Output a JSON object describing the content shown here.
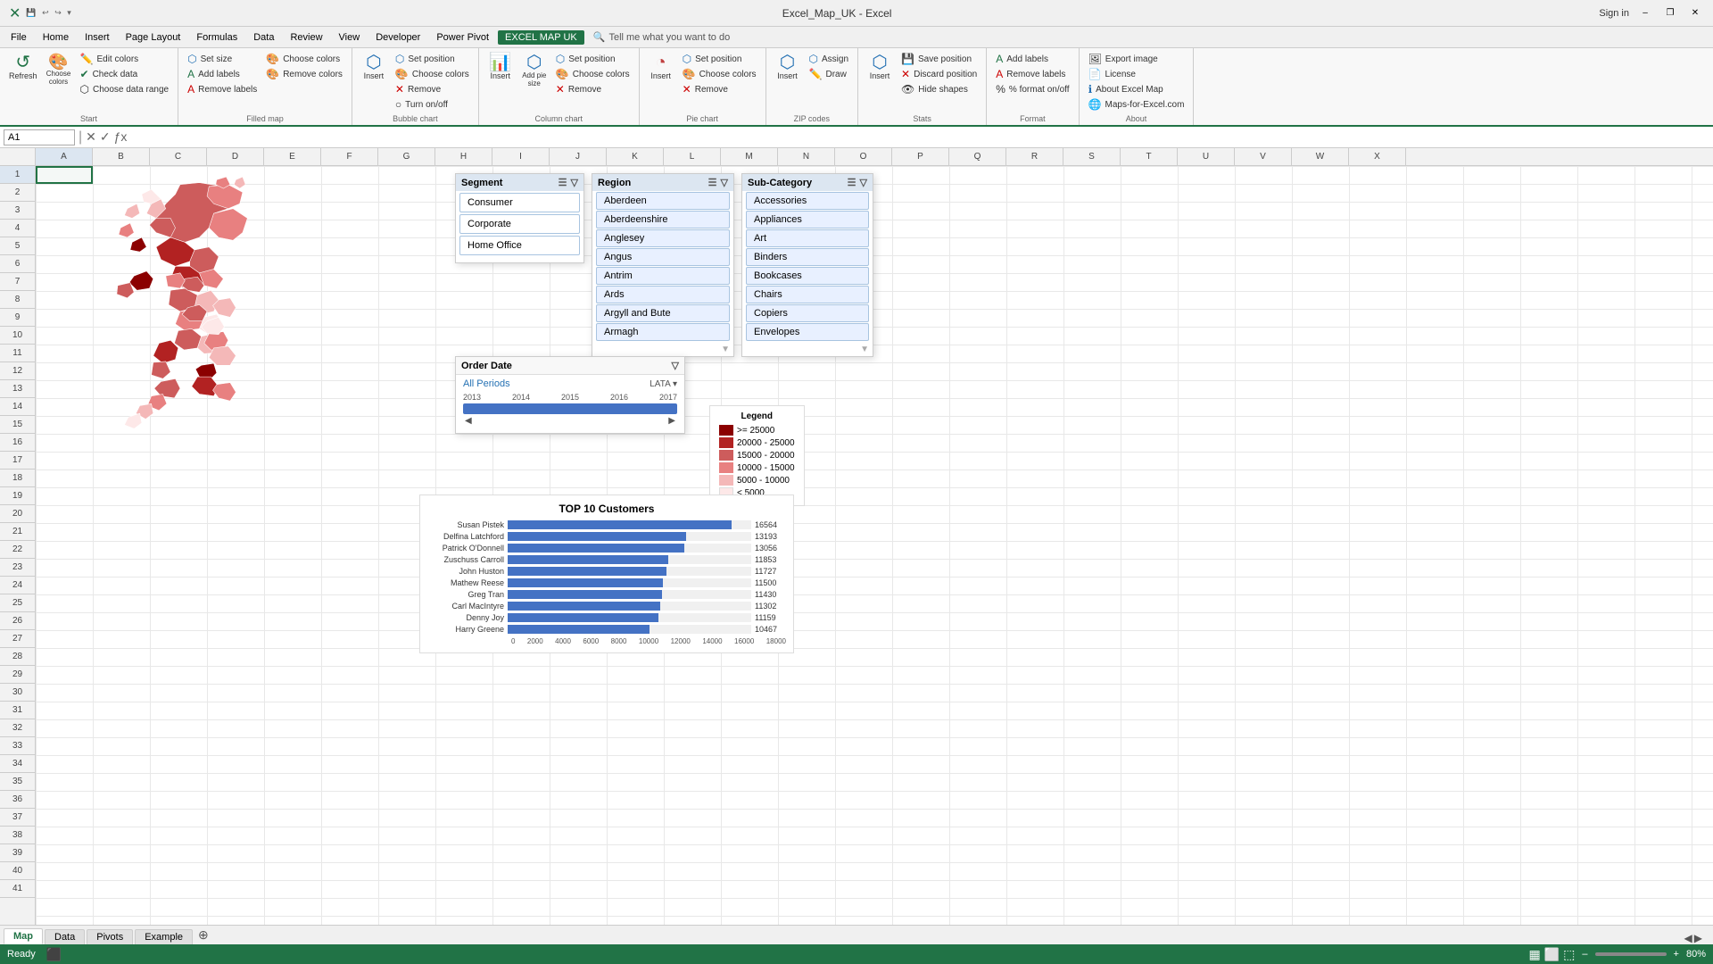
{
  "titlebar": {
    "title": "Excel_Map_UK - Excel",
    "signin": "Sign in",
    "minimize": "–",
    "restore": "❐",
    "close": "✕"
  },
  "menubar": {
    "items": [
      "File",
      "Home",
      "Insert",
      "Page Layout",
      "Formulas",
      "Data",
      "Review",
      "View",
      "Developer",
      "Power Pivot",
      "EXCEL MAP UK",
      "Tell me what you want to do"
    ]
  },
  "ribbon": {
    "groups": [
      {
        "label": "Start",
        "buttons": [
          {
            "id": "refresh",
            "icon": "↺",
            "label": "Refresh"
          },
          {
            "id": "choose-colors-start",
            "icon": "🎨",
            "label": "Choose colors"
          },
          {
            "id": "edit-colors",
            "icon": "✏️",
            "label": "Edit colors"
          },
          {
            "id": "check-data",
            "icon": "✔",
            "label": "Check data"
          },
          {
            "id": "choose-data-range",
            "icon": "⬡",
            "label": "Choose data range"
          }
        ]
      },
      {
        "label": "Filled map",
        "buttons": [
          {
            "id": "set-size",
            "icon": "⬡",
            "label": "Set size"
          },
          {
            "id": "add-labels",
            "icon": "A",
            "label": "Add labels"
          },
          {
            "id": "remove-labels",
            "icon": "A",
            "label": "Remove labels"
          },
          {
            "id": "choose-colors-filled",
            "icon": "🎨",
            "label": "Choose colors"
          },
          {
            "id": "remove-colors",
            "icon": "🎨",
            "label": "Remove colors"
          }
        ]
      },
      {
        "label": "Bubble chart",
        "buttons": [
          {
            "id": "insert-bubble",
            "icon": "⬡",
            "label": "Insert"
          },
          {
            "id": "set-position-bubble",
            "icon": "⬡",
            "label": "Set position"
          },
          {
            "id": "choose-colors-bubble",
            "icon": "🎨",
            "label": "Choose colors"
          },
          {
            "id": "remove-bubble",
            "icon": "✕",
            "label": "Remove"
          },
          {
            "id": "turn-onoff",
            "icon": "○",
            "label": "Turn on/off"
          }
        ]
      },
      {
        "label": "Column chart",
        "buttons": [
          {
            "id": "insert-column",
            "icon": "📊",
            "label": "Insert"
          },
          {
            "id": "add-pie-size",
            "icon": "⬡",
            "label": "Add pie size"
          },
          {
            "id": "set-position-column",
            "icon": "⬡",
            "label": "Set position"
          },
          {
            "id": "choose-colors-column",
            "icon": "🎨",
            "label": "Choose colors"
          },
          {
            "id": "remove-column",
            "icon": "✕",
            "label": "Remove"
          }
        ]
      },
      {
        "label": "Pie chart",
        "buttons": [
          {
            "id": "insert-pie",
            "icon": "📊",
            "label": "Insert"
          },
          {
            "id": "set-position-pie",
            "icon": "⬡",
            "label": "Set position"
          },
          {
            "id": "choose-colors-pie",
            "icon": "🎨",
            "label": "Choose colors"
          },
          {
            "id": "remove-pie",
            "icon": "✕",
            "label": "Remove"
          }
        ]
      },
      {
        "label": "ZIP codes",
        "buttons": [
          {
            "id": "insert-zip",
            "icon": "⬡",
            "label": "Insert"
          },
          {
            "id": "assign-zip",
            "icon": "⬡",
            "label": "Assign"
          },
          {
            "id": "draw-zip",
            "icon": "✏️",
            "label": "Draw"
          }
        ]
      },
      {
        "label": "Stats",
        "buttons": [
          {
            "id": "save-position",
            "icon": "💾",
            "label": "Save position"
          },
          {
            "id": "discard-position",
            "icon": "✕",
            "label": "Discard position"
          },
          {
            "id": "hide-shapes",
            "icon": "👁",
            "label": "Hide shapes"
          }
        ]
      },
      {
        "label": "Format",
        "buttons": [
          {
            "id": "add-labels-fmt",
            "icon": "A",
            "label": "Add labels"
          },
          {
            "id": "remove-labels-fmt",
            "icon": "A",
            "label": "Remove labels"
          },
          {
            "id": "pct-format",
            "icon": "%",
            "label": "% format on/off"
          }
        ]
      },
      {
        "label": "About",
        "buttons": [
          {
            "id": "export-image",
            "icon": "🖼",
            "label": "Export image"
          },
          {
            "id": "license",
            "icon": "📄",
            "label": "License"
          },
          {
            "id": "about-excelmap",
            "icon": "ℹ",
            "label": "About Excel Map"
          },
          {
            "id": "maps-for-excel",
            "icon": "🌐",
            "label": "Maps-for-Excel.com"
          }
        ]
      }
    ]
  },
  "formulabar": {
    "namebox": "A1",
    "formula": ""
  },
  "columns": [
    "A",
    "B",
    "C",
    "D",
    "E",
    "F",
    "G",
    "H",
    "I",
    "J",
    "K",
    "L",
    "M",
    "N",
    "O",
    "P",
    "Q",
    "R",
    "S",
    "T",
    "U",
    "V",
    "W",
    "X"
  ],
  "rows": [
    "1",
    "2",
    "3",
    "4",
    "5",
    "6",
    "7",
    "8",
    "9",
    "10",
    "11",
    "12",
    "13",
    "14",
    "15",
    "16",
    "17",
    "18",
    "19",
    "20",
    "21",
    "22",
    "23",
    "24",
    "25",
    "26",
    "27",
    "28",
    "29",
    "30",
    "31",
    "32",
    "33",
    "34",
    "35",
    "36",
    "37",
    "38",
    "39",
    "40",
    "41"
  ],
  "segment_panel": {
    "title": "Segment",
    "items": [
      "Consumer",
      "Corporate",
      "Home Office"
    ]
  },
  "region_panel": {
    "title": "Region",
    "items": [
      "Aberdeen",
      "Aberdeenshire",
      "Anglesey",
      "Angus",
      "Antrim",
      "Ards",
      "Argyll and Bute",
      "Armagh"
    ]
  },
  "subcategory_panel": {
    "title": "Sub-Category",
    "items": [
      "Accessories",
      "Appliances",
      "Art",
      "Binders",
      "Bookcases",
      "Chairs",
      "Copiers",
      "Envelopes"
    ]
  },
  "orderdate_panel": {
    "title": "Order Date",
    "all_periods": "All Periods",
    "mode": "LATA",
    "years": [
      "2013",
      "2014",
      "2015",
      "2016",
      "2017"
    ]
  },
  "legend": {
    "title": "Legend",
    "items": [
      {
        "label": ">= 25000",
        "color": "#8b0000"
      },
      {
        "label": "20000 - 25000",
        "color": "#b22222"
      },
      {
        "label": "15000 - 20000",
        "color": "#cd5c5c"
      },
      {
        "label": "10000 - 15000",
        "color": "#e88080"
      },
      {
        "label": "5000 - 10000",
        "color": "#f4b8b8"
      },
      {
        "label": "< 5000",
        "color": "#fde8e8"
      }
    ]
  },
  "barchart": {
    "title": "TOP 10 Customers",
    "bars": [
      {
        "name": "Susan Pistek",
        "value": 16564,
        "max": 18000
      },
      {
        "name": "Delfina Latchford",
        "value": 13193,
        "max": 18000
      },
      {
        "name": "Patrick O'Donnell",
        "value": 13056,
        "max": 18000
      },
      {
        "name": "Zuschuss Carroll",
        "value": 11853,
        "max": 18000
      },
      {
        "name": "John Huston",
        "value": 11727,
        "max": 18000
      },
      {
        "name": "Mathew Reese",
        "value": 11500,
        "max": 18000
      },
      {
        "name": "Greg Tran",
        "value": 11430,
        "max": 18000
      },
      {
        "name": "Carl MacIntyre",
        "value": 11302,
        "max": 18000
      },
      {
        "name": "Denny Joy",
        "value": 11159,
        "max": 18000
      },
      {
        "name": "Harry Greene",
        "value": 10467,
        "max": 18000
      }
    ],
    "axis_labels": [
      "0",
      "2000",
      "4000",
      "6000",
      "8000",
      "10000",
      "12000",
      "14000",
      "16000",
      "18000"
    ]
  },
  "sheets": [
    "Map",
    "Data",
    "Pivots",
    "Example"
  ],
  "active_sheet": "Map",
  "statusbar": {
    "left": "Ready",
    "right": "80%"
  },
  "colors": {
    "excel_green": "#217346",
    "ribbon_blue": "#2672b4",
    "header_blue": "#dce6f1"
  }
}
